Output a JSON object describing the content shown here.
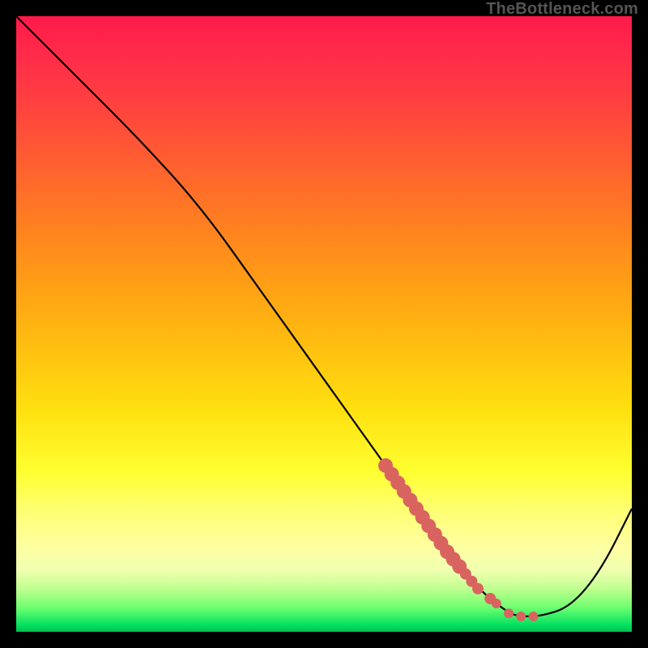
{
  "watermark": "TheBottleneck.com",
  "chart_data": {
    "type": "line",
    "title": "",
    "xlabel": "",
    "ylabel": "",
    "xlim": [
      0,
      100
    ],
    "ylim": [
      0,
      100
    ],
    "series": [
      {
        "name": "bottleneck-curve",
        "x": [
          0,
          10,
          20,
          30,
          40,
          50,
          60,
          65,
          70,
          75,
          80,
          82,
          85,
          90,
          95,
          100
        ],
        "y": [
          100,
          90,
          80,
          69,
          55,
          41,
          27,
          20,
          13,
          7,
          3,
          2.5,
          2.5,
          4,
          10,
          20
        ]
      }
    ],
    "highlight_points": {
      "name": "optimal-region",
      "x": [
        60,
        61,
        62,
        63,
        64,
        65,
        66,
        67,
        68,
        69,
        70,
        71,
        72,
        73,
        74,
        75,
        77,
        78,
        80,
        82,
        84
      ],
      "y": [
        27,
        25.6,
        24.2,
        22.8,
        21.4,
        20,
        18.6,
        17.2,
        15.8,
        14.4,
        13,
        11.8,
        10.6,
        9.4,
        8.2,
        7,
        5.4,
        4.6,
        3,
        2.5,
        2.5
      ]
    },
    "colors": {
      "curve": "#000000",
      "highlight": "#d9645f"
    }
  }
}
